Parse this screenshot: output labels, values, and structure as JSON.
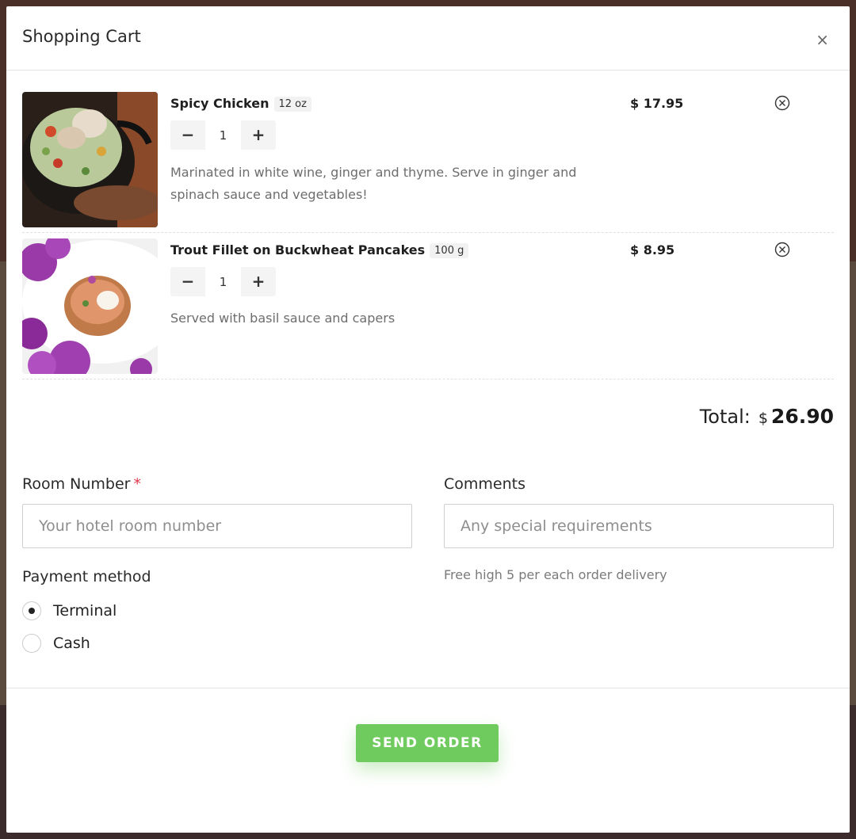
{
  "modal": {
    "title": "Shopping Cart",
    "close_glyph": "×"
  },
  "cart": {
    "items": [
      {
        "name": "Spicy Chicken",
        "size": "12 oz",
        "qty": "1",
        "minus": "−",
        "plus": "+",
        "description": "Marinated in white wine, ginger and thyme. Serve in ginger and spinach sauce and vegetables!",
        "price": "$ 17.95"
      },
      {
        "name": "Trout Fillet on Buckwheat Pancakes",
        "size": "100 g",
        "qty": "1",
        "minus": "−",
        "plus": "+",
        "description": "Served with basil sauce and capers",
        "price": "$ 8.95"
      }
    ],
    "total_label": "Total:",
    "total_currency": "$",
    "total_value": "26.90"
  },
  "form": {
    "room_label": "Room Number",
    "room_required": "*",
    "room_placeholder": "Your hotel room number",
    "comments_label": "Comments",
    "comments_placeholder": "Any special requirements",
    "hint": "Free high 5 per each order delivery",
    "payment_label": "Payment method",
    "payment_options": [
      {
        "label": "Terminal",
        "selected": true
      },
      {
        "label": "Cash",
        "selected": false
      }
    ]
  },
  "footer": {
    "send_label": "SEND ORDER"
  },
  "colors": {
    "accent_green": "#6fcb5e",
    "required_red": "#e0384a"
  }
}
